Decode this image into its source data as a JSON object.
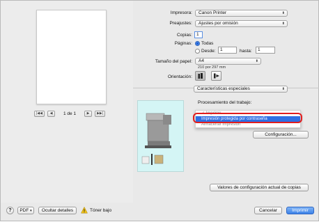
{
  "preview": {
    "page_label": "1 de 1",
    "first_glyph": "|◀◀",
    "prev_glyph": "◀",
    "next_glyph": "▶",
    "last_glyph": "▶▶|"
  },
  "form": {
    "printer": {
      "label": "Impresora:",
      "value": "Canon Printer"
    },
    "presets": {
      "label": "Preajustes:",
      "value": "Ajustes por omisión"
    },
    "copies": {
      "label": "Copias:",
      "value": "1"
    },
    "pages": {
      "label": "Páginas:",
      "all_label": "Todas",
      "from_label": "Desde:",
      "from_value": "1",
      "to_label": "hasta:",
      "to_value": "1",
      "selected": "Todas"
    },
    "paper_size": {
      "label": "Tamaño del papel:",
      "value": "A4",
      "dimensions": "210 por 297 mm"
    },
    "orientation": {
      "label": "Orientación:",
      "selected": "portrait"
    },
    "section": {
      "value": "Características especiales"
    }
  },
  "special": {
    "job_processing_label": "Procesamiento del trabajo:",
    "menu_items": [
      "✓ Imprimir",
      "Impresión protegida por contraseña",
      "Almacenar impresión"
    ],
    "highlighted_index": 1,
    "config_button": "Configuración...",
    "defaults_button": "Valores de configuración actual de copias"
  },
  "bottom": {
    "help": "?",
    "pdf": "PDF",
    "hide_details": "Ocultar detalles",
    "warning_text": "Tóner bajo",
    "cancel": "Cancelar",
    "print": "Imprimir"
  },
  "colors": {
    "accent": "#3c82e8",
    "highlight": "#2f6fe3",
    "callout": "#e21d1d",
    "panel_bg": "#d4f5f5"
  }
}
